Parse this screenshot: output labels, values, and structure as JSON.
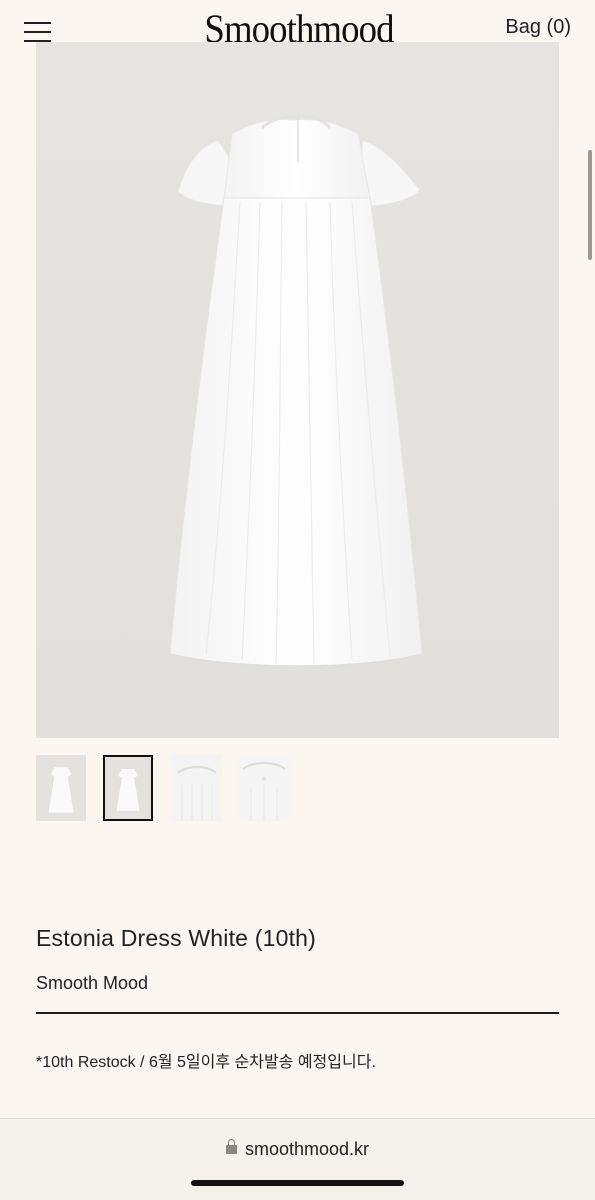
{
  "header": {
    "logo_text": "Smoothmood",
    "bag_label": "Bag (0)",
    "menu_icon": "hamburger-menu-icon"
  },
  "gallery": {
    "main_image": "white-dress-photo",
    "thumbnails": [
      {
        "image": "dress-front-thumbnail",
        "active": false
      },
      {
        "image": "dress-back-thumbnail",
        "active": true
      },
      {
        "image": "dress-collar-detail-thumbnail",
        "active": false
      },
      {
        "image": "dress-button-detail-thumbnail",
        "active": false
      }
    ]
  },
  "product": {
    "title": "Estonia Dress White (10th)",
    "brand": "Smooth Mood",
    "note": "*10th Restock / 6월 5일이후 순차발송 예정입니다."
  },
  "browser": {
    "url": "smoothmood.kr",
    "lock_icon": "lock-icon"
  },
  "colors": {
    "background": "#fbf6ef",
    "photo_background": "#e4e2de",
    "text": "#1e1e1e"
  }
}
